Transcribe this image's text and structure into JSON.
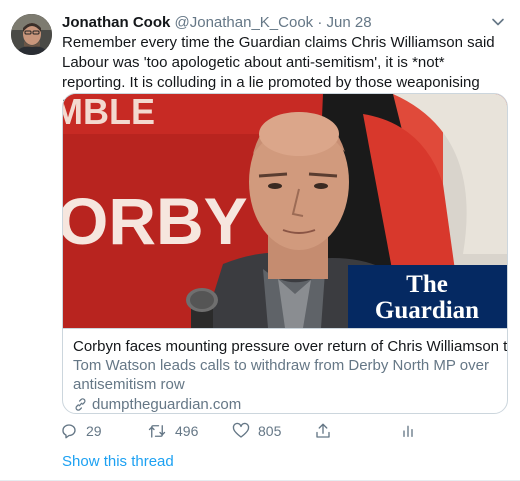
{
  "tweet": {
    "author_name": "Jonathan Cook",
    "handle": "@Jonathan_K_Cook",
    "separator": "·",
    "time": "Jun 28",
    "text": "Remember every time the Guardian claims Chris Williamson said Labour was 'too apologetic about anti-semitism', it is *not* reporting. It is colluding in a lie promoted by those weaponising anti-semitism to damage Corbyn"
  },
  "card": {
    "image_logo_line1": "The",
    "image_logo_line2": "Guardian",
    "banner_text_1": "ORBY",
    "banner_text_2": "MBLE",
    "title": "Corbyn faces mounting pressure over return of Chris Williamson to Labour",
    "description": "Tom Watson leads calls to withdraw from Derby North MP over antisemitism row",
    "domain": "dumptheguardian.com"
  },
  "actions": {
    "replies": "29",
    "retweets": "496",
    "likes": "805"
  },
  "show_thread": "Show this thread",
  "colors": {
    "link_blue": "#1da1f2",
    "guardian_blue": "#052962",
    "muted": "#657786"
  }
}
